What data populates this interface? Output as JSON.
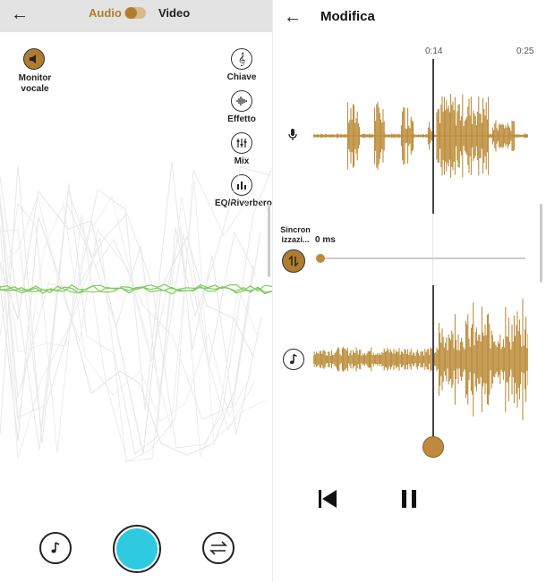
{
  "left": {
    "header": {
      "audio_label": "Audio",
      "video_label": "Video"
    },
    "monitor": {
      "label_line1": "Monitor",
      "label_line2": "vocale"
    },
    "tools": [
      {
        "label": "Chiave",
        "icon": "treble-clef-icon"
      },
      {
        "label": "Effetto",
        "icon": "waveform-icon"
      },
      {
        "label": "Mix",
        "icon": "mixer-icon"
      },
      {
        "label": "EQ/Riverbero",
        "icon": "equalizer-icon"
      }
    ],
    "bottom": {
      "left_icon": "music-note-icon",
      "center_icon": "record-button",
      "right_icon": "swap-icon"
    }
  },
  "right": {
    "header": {
      "title": "Modifica"
    },
    "timeline": {
      "mid_time": "0:14",
      "end_time": "0:25"
    },
    "sync": {
      "label_line1": "Sincron",
      "label_line2": "izzazi...",
      "value": "0 ms"
    },
    "controls": {
      "skip_icon": "skip-back-icon",
      "pause_icon": "pause-icon"
    }
  },
  "colors": {
    "accent": "#b07d2e",
    "record": "#2ecbe0",
    "wave": "#b8862f",
    "viz_green": "#7ecb5e",
    "topbar": "#e3e3e3"
  }
}
